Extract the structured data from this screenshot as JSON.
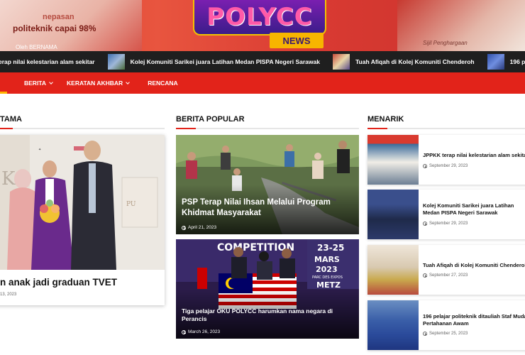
{
  "banner": {
    "left_text_1": "nepasan",
    "left_text_2": "politeknik capai 98%",
    "left_credit": "Oleh BERNAMA",
    "right_caption": "Sijil Penghargaan",
    "logo_text": "POLYCC",
    "logo_sub": "NEWS"
  },
  "ticker": {
    "items": [
      {
        "label": "erap nilai kelestarian alam sekitar"
      },
      {
        "label": "Kolej Komuniti Sarikei juara Latihan Medan PISPA Negeri Sarawak"
      },
      {
        "label": "Tuah Afiqah di Kolej Komuniti Chenderoh"
      },
      {
        "label": "196 pelajar politeknik ditaul"
      }
    ]
  },
  "nav": {
    "items": [
      {
        "label": "BERITA"
      },
      {
        "label": "KERATAN AKHBAR"
      },
      {
        "label": "RENCANA"
      }
    ]
  },
  "sections": {
    "left_title": "TAMA",
    "popular_title": "BERITA POPULAR",
    "menarik_title": "MENARIK"
  },
  "featured": {
    "title": "n anak jadi graduan TVET",
    "date": "13, 2023",
    "image_text": "POLYCC"
  },
  "popular": [
    {
      "title": "PSP Terap Nilai Ihsan Melalui Program Khidmat Masyarakat",
      "date": "April 21, 2023"
    },
    {
      "title": "Tiga pelajar OKU POLYCC harumkan nama negara di Perancis",
      "date": "March 26, 2023",
      "banner_text": "COMPETITION",
      "banner_dates": "23-25",
      "banner_month": "MARS",
      "banner_year": "2023",
      "banner_venue": "PARC DES EXPOS",
      "banner_city": "METZ"
    }
  ],
  "menarik": [
    {
      "title": "JPPKK terap nilai kelestarian alam sekitar",
      "date": "September 29, 2023"
    },
    {
      "title": "Kolej Komuniti Sarikei juara Latihan Medan PISPA Negeri Sarawak",
      "date": "September 29, 2023"
    },
    {
      "title": "Tuah Afiqah di Kolej Komuniti Chenderoh",
      "date": "September 27, 2023"
    },
    {
      "title": "196 pelajar politeknik ditauliah Staf Muda Pertahanan Awam",
      "date": "September 25, 2023"
    }
  ],
  "colors": {
    "brand_red": "#e2231a",
    "nav_underline": "#ffb400",
    "ticker_bg": "#1f1f1f"
  }
}
